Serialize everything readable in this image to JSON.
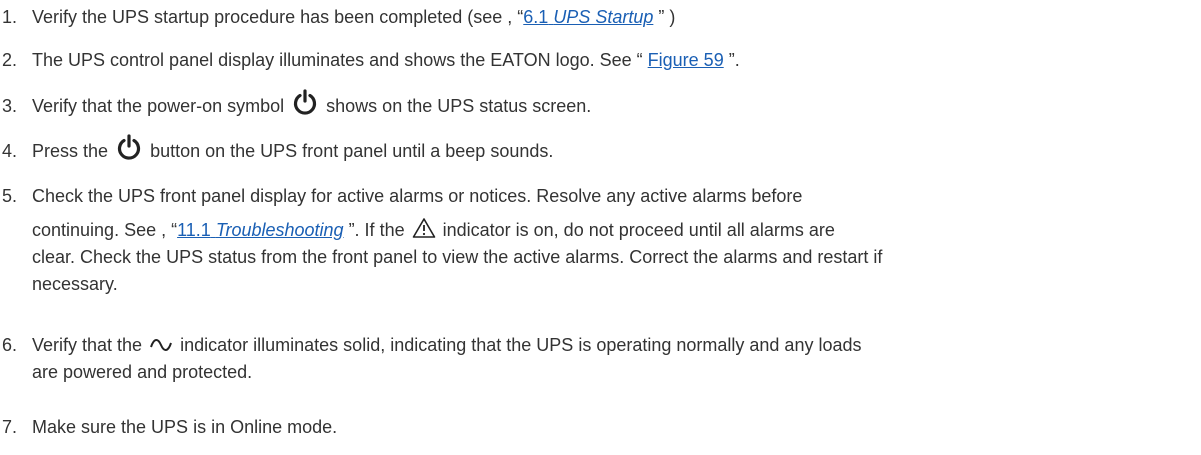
{
  "steps": [
    {
      "number": "1.",
      "text_before": "Verify the UPS startup procedure has been completed (see , “",
      "link_num": "6.1",
      "link_title": "UPS Startup",
      "text_after": " ” )"
    },
    {
      "number": "2.",
      "text_before": "The UPS control panel display illuminates and shows the EATON logo. See “ ",
      "link_text": "Figure 59",
      "text_after": " ”."
    },
    {
      "number": "3.",
      "text_before": "Verify that the power-on symbol",
      "icon": "power-icon",
      "text_after": "shows on the UPS status screen."
    },
    {
      "number": "4.",
      "text_before": "Press the",
      "icon": "power-icon",
      "text_after": "button on the UPS front panel until a beep sounds."
    },
    {
      "number": "5.",
      "line1": "Check the UPS front panel display for active alarms or notices. Resolve any active alarms before",
      "text_before": "continuing. See , “",
      "link_num": "11.1",
      "link_title": "Troubleshooting",
      "text_mid": " ”. If the",
      "icon": "warning-triangle-icon",
      "text_after": "indicator is on, do not proceed until all alarms are",
      "line3": "clear. Check the UPS status from the front panel to view the active alarms. Correct the alarms and restart if",
      "line4": "necessary."
    },
    {
      "number": "6.",
      "text_before": "Verify that the",
      "icon": "sine-wave-icon",
      "text_after": "indicator illuminates solid, indicating that the UPS is operating normally and any loads",
      "line2": "are powered and protected."
    },
    {
      "number": "7.",
      "text": "Make sure the UPS is in Online mode."
    }
  ],
  "colors": {
    "text": "#333333",
    "link": "#1a5fb4",
    "icon": "#222222"
  }
}
